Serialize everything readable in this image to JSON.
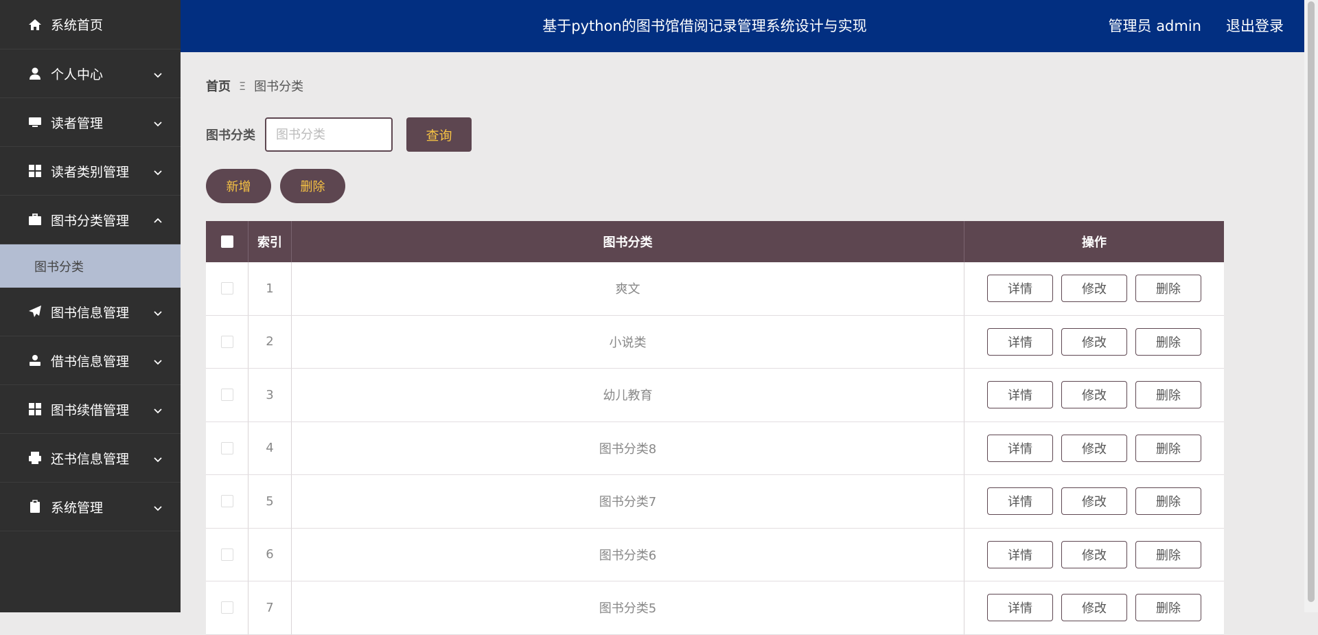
{
  "header": {
    "title": "基于python的图书馆借阅记录管理系统设计与实现",
    "user_label": "管理员 admin",
    "logout_label": "退出登录"
  },
  "sidebar": {
    "items": [
      {
        "label": "系统首页",
        "icon": "home-icon",
        "expandable": false
      },
      {
        "label": "个人中心",
        "icon": "user-icon",
        "expandable": true
      },
      {
        "label": "读者管理",
        "icon": "monitor-icon",
        "expandable": true
      },
      {
        "label": "读者类别管理",
        "icon": "grid-icon",
        "expandable": true
      },
      {
        "label": "图书分类管理",
        "icon": "briefcase-icon",
        "expandable": true,
        "expanded": true
      },
      {
        "label": "图书信息管理",
        "icon": "paper-plane-icon",
        "expandable": true
      },
      {
        "label": "借书信息管理",
        "icon": "user-card-icon",
        "expandable": true
      },
      {
        "label": "图书续借管理",
        "icon": "grid-icon",
        "expandable": true
      },
      {
        "label": "还书信息管理",
        "icon": "printer-icon",
        "expandable": true
      },
      {
        "label": "系统管理",
        "icon": "clipboard-icon",
        "expandable": true
      }
    ],
    "submenu_active": "图书分类"
  },
  "breadcrumb": {
    "home": "首页",
    "separator": "Ξ",
    "current": "图书分类"
  },
  "search": {
    "label": "图书分类",
    "placeholder": "图书分类",
    "value": "",
    "button": "查询"
  },
  "actions": {
    "add": "新增",
    "delete": "删除"
  },
  "table": {
    "headers": {
      "index": "索引",
      "name": "图书分类",
      "ops": "操作"
    },
    "op_labels": {
      "detail": "详情",
      "edit": "修改",
      "delete": "删除"
    },
    "rows": [
      {
        "index": "1",
        "name": "爽文"
      },
      {
        "index": "2",
        "name": "小说类"
      },
      {
        "index": "3",
        "name": "幼儿教育"
      },
      {
        "index": "4",
        "name": "图书分类8"
      },
      {
        "index": "5",
        "name": "图书分类7"
      },
      {
        "index": "6",
        "name": "图书分类6"
      },
      {
        "index": "7",
        "name": "图书分类5"
      }
    ]
  },
  "colors": {
    "sidebar_bg": "#2f2f2f",
    "header_bg": "#022f81",
    "accent": "#5d4650",
    "accent_text": "#f6c243",
    "submenu_bg": "#b3bdd2",
    "page_bg": "#ebeaea"
  }
}
